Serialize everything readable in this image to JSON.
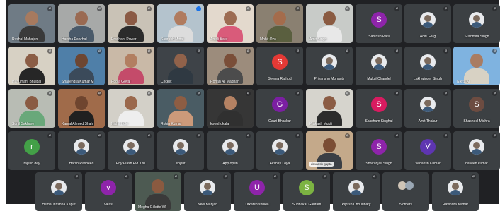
{
  "participants": [
    {
      "name": "Rushal Mahajan",
      "kind": "video",
      "muted": true,
      "wall": "#6f7b85",
      "skin": "#a77a5f",
      "shirt": "#3a3a3a"
    },
    {
      "name": "Harsha Panchal",
      "kind": "video",
      "muted": true,
      "wall": "#a7a9a8",
      "skin": "#9a6a52",
      "shirt": "#4a5a6a"
    },
    {
      "name": "Prashant Powar",
      "kind": "video",
      "muted": true,
      "wall": "#c9c2b6",
      "skin": "#8b5a44",
      "shirt": "#2b2b2b"
    },
    {
      "name": "Saurabh Mittal",
      "kind": "video",
      "muted": false,
      "active": true,
      "wall": "#b4c3cd",
      "skin": "#b07b5e",
      "shirt": "#dcdcdc"
    },
    {
      "name": "Anjali Kaur",
      "kind": "video",
      "muted": true,
      "wall": "#e3d9cd",
      "skin": "#9c6b52",
      "shirt": "#d95b7a"
    },
    {
      "name": "Mohit Oza",
      "kind": "video",
      "muted": true,
      "wall": "#8a8071",
      "skin": "#a46c4c",
      "shirt": "#5a5f3f"
    },
    {
      "name": "Amit Singh",
      "kind": "video",
      "muted": true,
      "wall": "#c8cbc8",
      "skin": "#8a5a41",
      "shirt": "#e8e8e8"
    },
    {
      "name": "Santosh Patil",
      "kind": "avatar",
      "muted": true,
      "letter": "S",
      "color": "#8e24aa"
    },
    {
      "name": "Aditi Garg",
      "kind": "photo",
      "muted": true
    },
    {
      "name": "Sushmita Singh",
      "kind": "photo",
      "muted": true
    },
    {
      "name": "Hanumant Bhujbal",
      "kind": "video",
      "muted": true,
      "wall": "#d7d1c4",
      "skin": "#8b5d45",
      "shirt": "#262626"
    },
    {
      "name": "Shailendra Kumar M",
      "kind": "video",
      "muted": true,
      "wall": "#4f7fa8",
      "skin": "#6d4632",
      "shirt": "#3b4a5a"
    },
    {
      "name": "Pooja Goyal",
      "kind": "video",
      "muted": true,
      "wall": "#c9b9a7",
      "skin": "#b27f61",
      "shirt": "#c44b6a"
    },
    {
      "name": "Cricket",
      "kind": "video",
      "muted": true,
      "wall": "#3e4348",
      "skin": "#91624a",
      "shirt": "#2f3942"
    },
    {
      "name": "Rohan Ali Madhan",
      "kind": "video",
      "muted": true,
      "wall": "#9c8c7c",
      "skin": "#7a4e38",
      "shirt": "#4c4c4c"
    },
    {
      "name": "Seema Rathod",
      "kind": "avatar",
      "muted": true,
      "letter": "S",
      "color": "#e53935"
    },
    {
      "name": "Priyanshu Mohanty",
      "kind": "photo",
      "muted": true
    },
    {
      "name": "Mukul Chandel",
      "kind": "photo",
      "muted": true
    },
    {
      "name": "Lakhwinder Singh",
      "kind": "photo",
      "muted": true
    },
    {
      "name": "Nikita Ai",
      "kind": "video",
      "muted": true,
      "wall": "#7fb3e0",
      "skin": "#a97c62",
      "shirt": "#d8d2c4"
    },
    {
      "name": "Sunil Sakhare",
      "kind": "video",
      "muted": true,
      "wall": "#b8bcb4",
      "skin": "#8a5b43",
      "shirt": "#69a87a"
    },
    {
      "name": "Kamal Ahmed Shah",
      "kind": "video",
      "muted": true,
      "wall": "#a06b4a",
      "skin": "#6f452f",
      "shirt": "#202020"
    },
    {
      "name": "Nikhil Hole",
      "kind": "video",
      "muted": true,
      "wall": "#d3d0c8",
      "skin": "#9a684c",
      "shirt": "#eeeeee"
    },
    {
      "name": "Robin Kumar",
      "kind": "video",
      "muted": true,
      "wall": "#4a5c64",
      "skin": "#8d5d43",
      "shirt": "#cc9a7a"
    },
    {
      "name": "kowshokala",
      "kind": "video",
      "muted": true,
      "wall": "#363636",
      "skin": "#b58263",
      "shirt": "#303030"
    },
    {
      "name": "Gauri Bhaskar",
      "kind": "avatar",
      "muted": true,
      "letter": "G",
      "color": "#7b1fa2"
    },
    {
      "name": "Prakash Mukti",
      "kind": "video",
      "muted": true,
      "wall": "#d6d4cd",
      "skin": "#8b5c44",
      "shirt": "#2c2c2c"
    },
    {
      "name": "Saksham Singhal",
      "kind": "avatar",
      "muted": true,
      "letter": "S",
      "color": "#d81b60"
    },
    {
      "name": "Amit Thakur",
      "kind": "photo",
      "muted": true
    },
    {
      "name": "Shasheel Mishra",
      "kind": "avatar",
      "muted": true,
      "letter": "S",
      "color": "#6d4c41"
    },
    {
      "name": "rajesh dey",
      "kind": "avatar",
      "muted": true,
      "letter": "r",
      "color": "#43a047"
    },
    {
      "name": "Harsh Rasheed",
      "kind": "photo",
      "muted": true
    },
    {
      "name": "PhyAkash Pvt. Ltd.",
      "kind": "photo",
      "muted": true
    },
    {
      "name": "spylnt",
      "kind": "photo",
      "muted": true
    },
    {
      "name": "App open",
      "kind": "photo",
      "muted": true
    },
    {
      "name": "Akshay Loya",
      "kind": "photo",
      "muted": true
    },
    {
      "name": "devansh gupta",
      "kind": "video",
      "muted": true,
      "pinned": true,
      "wall": "#c4a98a",
      "skin": "#7b4d34",
      "shirt": "#3b3f45"
    },
    {
      "name": "Shivranjali Singh",
      "kind": "avatar",
      "muted": true,
      "letter": "S",
      "color": "#8e24aa"
    },
    {
      "name": "Vedansh Kumar",
      "kind": "avatar",
      "muted": true,
      "letter": "V",
      "color": "#5e35b1"
    },
    {
      "name": "naveen kumar",
      "kind": "photo",
      "muted": true
    },
    {
      "name": "Hemal Krishna Kaput",
      "kind": "photo",
      "muted": true
    },
    {
      "name": "vikas",
      "kind": "avatar",
      "muted": true,
      "letter": "v",
      "color": "#8e24aa"
    },
    {
      "name": "Megha Gillette Wl",
      "kind": "video",
      "muted": true,
      "wall": "#4d5a52",
      "skin": "#8a5a40",
      "shirt": "#3a3a3a"
    },
    {
      "name": "Neel Manjan",
      "kind": "photo",
      "muted": true
    },
    {
      "name": "Utkarsh shukla",
      "kind": "avatar",
      "muted": true,
      "letter": "U",
      "color": "#8e24aa"
    },
    {
      "name": "Sudhakar Gautam",
      "kind": "avatar",
      "muted": true,
      "letter": "S",
      "color": "#7cb342"
    },
    {
      "name": "Piyush Choudhary",
      "kind": "photo",
      "muted": true
    },
    {
      "name": "5 others",
      "kind": "others",
      "muted": false
    },
    {
      "name": "Ravindra Kumar",
      "kind": "photo",
      "muted": true
    }
  ],
  "icons": {
    "muted": "mic-off-icon",
    "active": "speaking-indicator-icon"
  }
}
